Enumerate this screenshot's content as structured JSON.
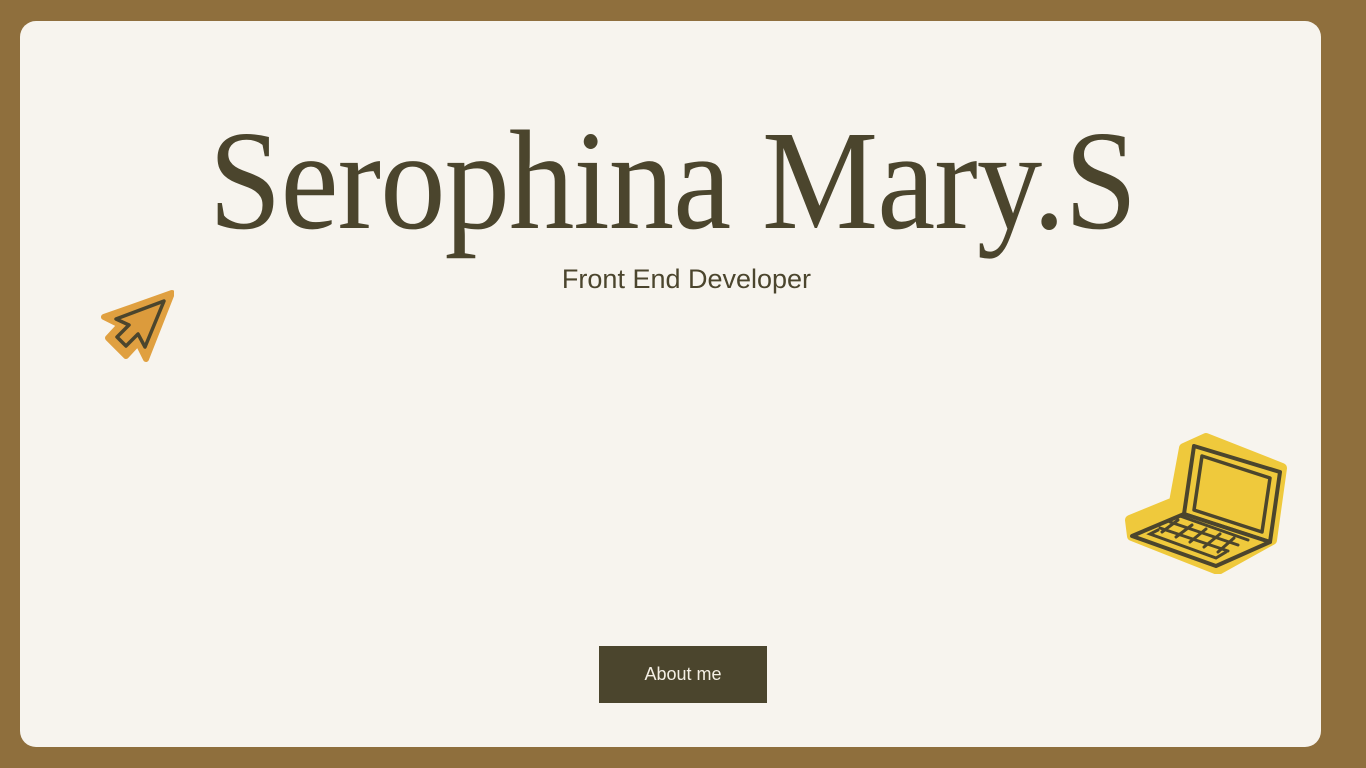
{
  "hero": {
    "name": "Serophina Mary.S",
    "role": "Front End Developer",
    "cta_label": "About me"
  },
  "icons": {
    "left": "cursor-arrow-icon",
    "right": "laptop-icon"
  },
  "colors": {
    "frame": "#8f6f3d",
    "card": "#f7f4ee",
    "text": "#4b452d",
    "button": "#4b452d",
    "cursor_fill": "#e0a040",
    "laptop_fill": "#efc93c"
  }
}
